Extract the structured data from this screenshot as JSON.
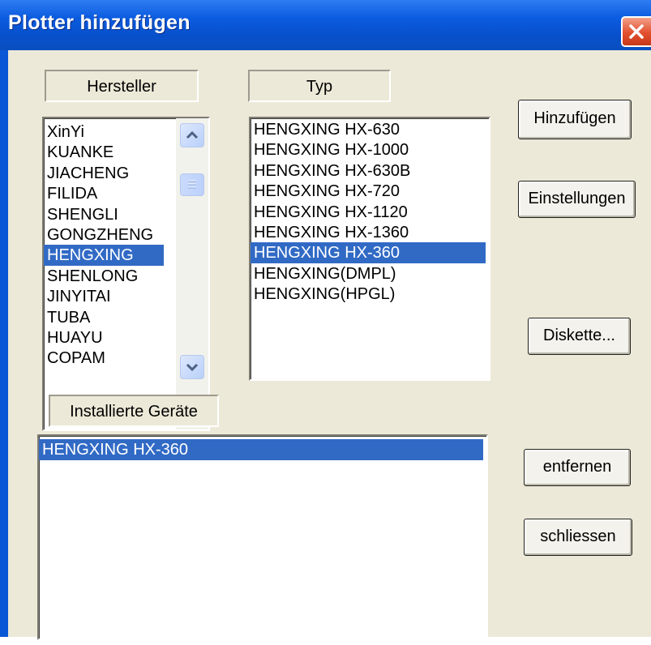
{
  "window": {
    "title": "Plotter hinzufügen"
  },
  "labels": {
    "manufacturer": "Hersteller",
    "type": "Typ",
    "installed": "Installierte Geräte"
  },
  "manufacturers": {
    "items": [
      "XinYi",
      "KUANKE",
      "JIACHENG",
      "FILIDA",
      "SHENGLI",
      "GONGZHENG",
      "HENGXING",
      "SHENLONG",
      "JINYITAI",
      "TUBA",
      "HUAYU",
      "COPAM"
    ],
    "selected": "HENGXING"
  },
  "types": {
    "items": [
      "HENGXING HX-630",
      "HENGXING HX-1000",
      "HENGXING HX-630B",
      "HENGXING HX-720",
      "HENGXING HX-1120",
      "HENGXING HX-1360",
      "HENGXING HX-360",
      "HENGXING(DMPL)",
      "HENGXING(HPGL)"
    ],
    "selected": "HENGXING HX-360"
  },
  "installed": {
    "items": [
      "HENGXING HX-360"
    ],
    "selected": "HENGXING HX-360"
  },
  "buttons": {
    "add": "Hinzufügen",
    "settings": "Einstellungen",
    "disk": "Diskette...",
    "remove": "entfernen",
    "close": "schliessen"
  },
  "colors": {
    "selection": "#316ac5",
    "title_bar": "#0a57d6",
    "dialog_bg": "#ece9d8",
    "close_button": "#e2502e"
  },
  "icons": {
    "close": "close-x-icon",
    "scroll_up": "chevron-up-icon",
    "scroll_down": "chevron-down-icon",
    "scroll_thumb": "scroll-thumb-grip-icon"
  }
}
